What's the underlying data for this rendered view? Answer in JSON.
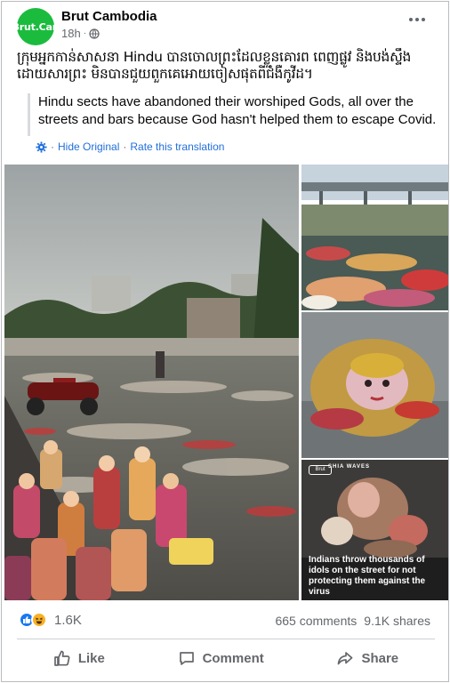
{
  "post": {
    "avatar_text": "Brut.Can",
    "page_name": "Brut Cambodia",
    "time": "18h",
    "caption": "ក្រុមអ្នកកាន់សាសនា Hindu បានចោលព្រះដែលខ្លួនគោរព ពេញផ្លូវ និងបង់ស្ទឹង ដោយសារព្រះ មិនបានជួយពួកគេអោយចៀសផុតពីជំងឺកូវីដ។",
    "translation": "Hindu sects have abandoned their worshiped Gods, all over the streets and bars because God hasn't helped them to escape Covid.",
    "hide_original": "Hide Original",
    "rate_translation": "Rate this translation",
    "separator": "·"
  },
  "photos": {
    "overlay_caption": "Indians throw thousands of idols on the street for not protecting them against the virus",
    "brand_tag": "Brut",
    "overlay_brand": "SHIA WAVES"
  },
  "engagement": {
    "reactions_count": "1.6K",
    "comments": "665 comments",
    "shares": "9.1K shares"
  },
  "actions": {
    "like": "Like",
    "comment": "Comment",
    "share": "Share"
  },
  "colors": {
    "avatar": "#1bbc3e",
    "link": "#216fdb",
    "like_reaction": "#1877f2",
    "haha_reaction": "#f7b125"
  },
  "icons": [
    "globe-icon",
    "more-options-icon",
    "gear-icon",
    "like-icon",
    "comment-icon",
    "share-icon"
  ]
}
